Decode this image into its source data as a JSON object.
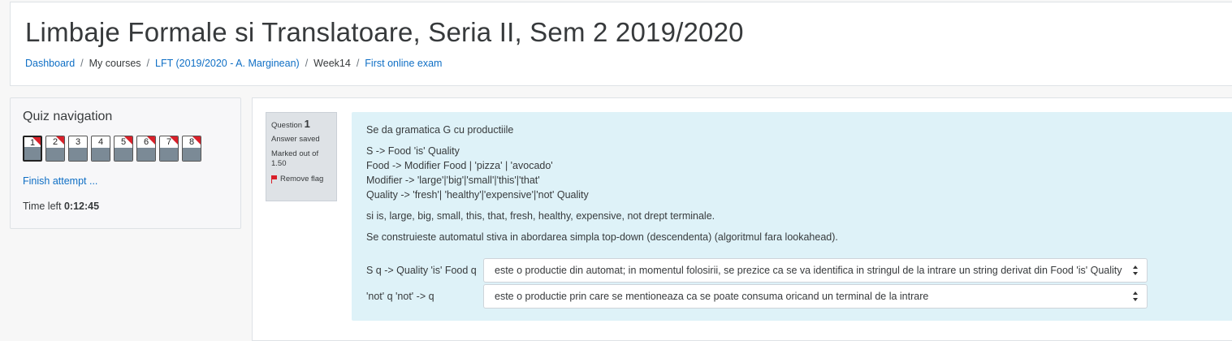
{
  "page": {
    "title": "Limbaje Formale si Translatoare, Seria II, Sem 2 2019/2020",
    "breadcrumb": [
      {
        "label": "Dashboard",
        "link": true
      },
      {
        "label": "My courses",
        "link": false
      },
      {
        "label": "LFT (2019/2020 - A. Marginean)",
        "link": true
      },
      {
        "label": "Week14",
        "link": false
      },
      {
        "label": "First online exam",
        "link": true
      }
    ]
  },
  "quiz_nav": {
    "title": "Quiz navigation",
    "buttons": [
      {
        "label": "1",
        "current": true,
        "flagged": true
      },
      {
        "label": "2",
        "current": false,
        "flagged": true
      },
      {
        "label": "3",
        "current": false,
        "flagged": false
      },
      {
        "label": "4",
        "current": false,
        "flagged": false
      },
      {
        "label": "5",
        "current": false,
        "flagged": true
      },
      {
        "label": "6",
        "current": false,
        "flagged": true
      },
      {
        "label": "7",
        "current": false,
        "flagged": true
      },
      {
        "label": "8",
        "current": false,
        "flagged": true
      }
    ],
    "finish_label": "Finish attempt ...",
    "time_label": "Time left",
    "time_value": "0:12:45"
  },
  "question": {
    "label": "Question",
    "number": "1",
    "state": "Answer saved",
    "marked_out_of": "Marked out of 1.50",
    "remove_flag": "Remove flag",
    "text": {
      "intro": "Se da gramatica G cu productiile",
      "rules": [
        "S -> Food 'is' Quality",
        "Food -> Modifier Food | 'pizza' | 'avocado'",
        "Modifier -> 'large'|'big'|'small'|'this'|'that'",
        "Quality -> 'fresh'| 'healthy'|'expensive'|'not' Quality"
      ],
      "terminals": "si is, large, big, small, this, that, fresh, healthy, expensive, not drept terminale.",
      "instruction": "Se construieste automatul stiva in abordarea simpla top-down (descendenta) (algoritmul fara lookahead)."
    },
    "matches": [
      {
        "stem": "S q -> Quality 'is' Food q",
        "selected": "este o productie din automat; in momentul folosirii, se prezice ca se va identifica in stringul de la intrare un string derivat din Food 'is' Quality"
      },
      {
        "stem": "'not' q 'not' -> q",
        "selected": "este o productie prin care se mentioneaza ca se poate consuma oricand un terminal de la intrare"
      }
    ]
  },
  "colors": {
    "link": "#0f6fc5",
    "question_bg": "#def2f8",
    "flag": "#d9202a"
  }
}
